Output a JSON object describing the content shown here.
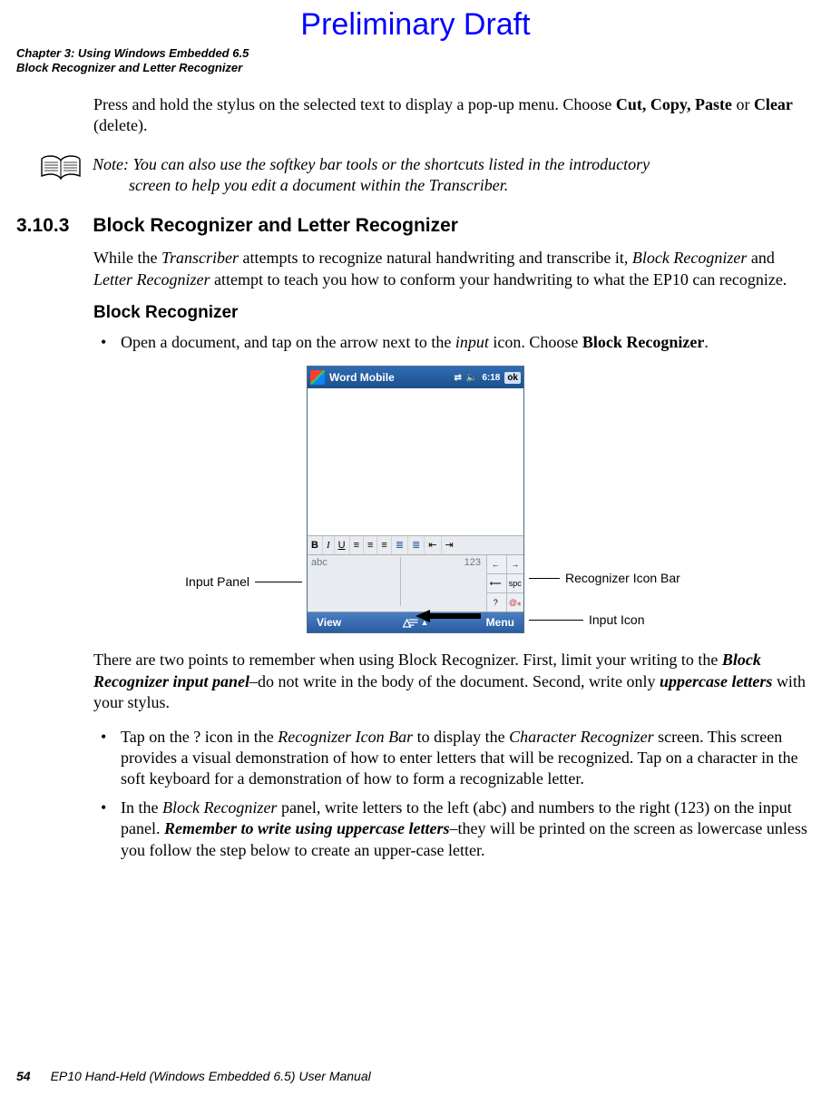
{
  "draft_banner": "Preliminary Draft",
  "running_head": {
    "line1": "Chapter 3: Using Windows Embedded 6.5",
    "line2": "Block Recognizer and Letter Recognizer"
  },
  "intro": {
    "pre": "Press and hold the stylus on the selected text to display a pop-up menu. Choose ",
    "bold1": "Cut, Copy, Paste",
    "mid": " or ",
    "bold2": "Clear",
    "post": " (delete)."
  },
  "note": {
    "label": "Note: ",
    "line1": "You can also use the softkey bar tools or the shortcuts listed in the introductory",
    "line2": "screen to help you edit a document within the Transcriber."
  },
  "h2": {
    "num": "3.10.3",
    "title": "Block Recognizer and Letter Recognizer"
  },
  "para1": {
    "a": "While the ",
    "i1": "Transcriber",
    "b": " attempts to recognize natural handwriting and transcribe it, ",
    "i2": "Block Recognizer",
    "c": " and ",
    "i3": "Letter Recognizer",
    "d": " attempt to teach you how to conform your handwriting to what the EP10 can recognize."
  },
  "h3": "Block Recognizer",
  "bullet_open": {
    "a": "Open a document, and tap on the arrow next to the ",
    "i1": "input",
    "b": " icon. Choose ",
    "bold": "Block Recognizer",
    "c": "."
  },
  "figure": {
    "title": "Word Mobile",
    "time": "6:18",
    "ok": "ok",
    "toolbar": {
      "b": "B",
      "i": "I",
      "u": "U"
    },
    "sip": {
      "abc": "abc",
      "n123": "123",
      "spc": "spc"
    },
    "bottom": {
      "view": "View",
      "menu": "Menu"
    },
    "callouts": {
      "input_panel": "Input Panel",
      "recognizer_bar": "Recognizer Icon Bar",
      "input_icon": "Input Icon"
    }
  },
  "para2": {
    "a": "There are two points to remember when using Block Recognizer. First, limit your writing to the ",
    "bi1": "Block Recognizer input panel",
    "b": "–do not write in the body of the document. Second, write only ",
    "bi2": "uppercase letters",
    "c": " with your stylus."
  },
  "bullets2": {
    "item1": {
      "a": "Tap on the ? icon in the ",
      "i1": "Recognizer Icon Bar",
      "b": " to display the ",
      "i2": "Character Recognizer",
      "c": " screen. This screen provides a visual demonstration of how to enter letters that will be recognized. Tap on a character in the soft keyboard for a demonstration of how to form a recognizable letter."
    },
    "item2": {
      "a": "In the ",
      "i1": "Block Recognizer",
      "b": " panel, write letters to the left (abc) and numbers to the right (123) on the input panel. ",
      "bi1": "Remember to write using uppercase letters",
      "c": "–they will be printed on the screen as lowercase unless you follow the step below to create an upper-case letter."
    }
  },
  "footer": {
    "page": "54",
    "title": "EP10 Hand-Held (Windows Embedded 6.5) User Manual"
  }
}
